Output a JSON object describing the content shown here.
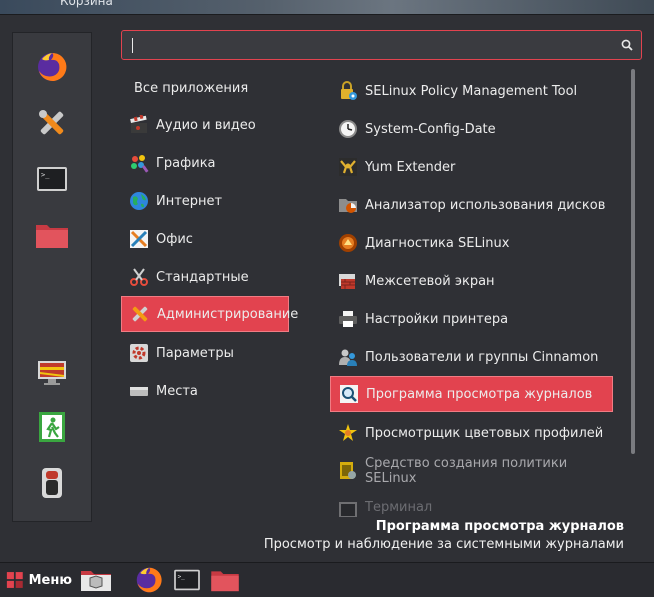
{
  "desktop": {
    "trash_label": "Корзина"
  },
  "search": {
    "value": "",
    "icon": "search-icon"
  },
  "favorites": [
    {
      "name": "firefox",
      "icon": "firefox-icon"
    },
    {
      "name": "system-settings",
      "icon": "tools-icon"
    },
    {
      "name": "terminal",
      "icon": "terminal-icon"
    },
    {
      "name": "files",
      "icon": "folder-icon"
    },
    {
      "name": "lock-screen",
      "icon": "lock-screen-icon"
    },
    {
      "name": "logout",
      "icon": "exit-icon"
    },
    {
      "name": "shutdown",
      "icon": "power-icon"
    }
  ],
  "categories": [
    {
      "label": "Все приложения",
      "icon": ""
    },
    {
      "label": "Аудио и видео",
      "icon": "clapper-icon"
    },
    {
      "label": "Графика",
      "icon": "palette-icon"
    },
    {
      "label": "Интернет",
      "icon": "globe-icon"
    },
    {
      "label": "Офис",
      "icon": "office-icon"
    },
    {
      "label": "Стандартные",
      "icon": "scissors-icon"
    },
    {
      "label": "Администрирование",
      "icon": "tools-icon",
      "active": true
    },
    {
      "label": "Параметры",
      "icon": "settings-icon"
    },
    {
      "label": "Места",
      "icon": "drive-icon"
    }
  ],
  "apps": [
    {
      "label": "SELinux Policy Management Tool",
      "icon": "lock-gear-icon"
    },
    {
      "label": "System-Config-Date",
      "icon": "clock-icon"
    },
    {
      "label": "Yum Extender",
      "icon": "yumex-icon"
    },
    {
      "label": "Анализатор использования дисков",
      "icon": "disk-usage-icon"
    },
    {
      "label": "Диагностика SELinux",
      "icon": "selinux-troubleshoot-icon"
    },
    {
      "label": "Межсетевой экран",
      "icon": "firewall-icon"
    },
    {
      "label": "Настройки принтера",
      "icon": "printer-icon"
    },
    {
      "label": "Пользователи и группы Cinnamon",
      "icon": "users-icon"
    },
    {
      "label": "Программа просмотра журналов",
      "icon": "log-viewer-icon",
      "active": true
    },
    {
      "label": "Просмотрщик цветовых профилей",
      "icon": "color-profile-icon"
    },
    {
      "label": "Средство создания политики SELinux",
      "icon": "policy-generator-icon",
      "dim": true
    },
    {
      "label": "Терминал",
      "icon": "terminal-icon",
      "faded": true
    }
  ],
  "description": {
    "title": "Программа просмотра журналов",
    "text": "Просмотр и наблюдение за системными журналами"
  },
  "taskbar": {
    "menu_label": "Меню",
    "items": [
      "show-desktop-icon",
      "firefox-icon",
      "terminal-icon",
      "folder-icon"
    ]
  },
  "colors": {
    "accent": "#e2434f",
    "panel": "#2f3035",
    "favbar": "#393a3f"
  }
}
